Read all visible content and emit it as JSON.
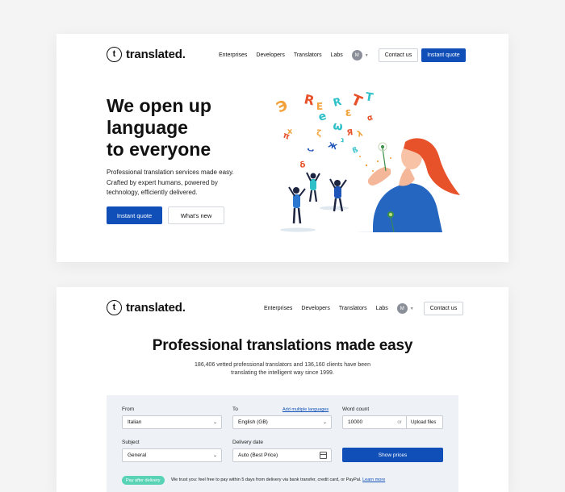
{
  "brand": {
    "name": "translated.",
    "mark": "t"
  },
  "nav": {
    "links": [
      "Enterprises",
      "Developers",
      "Translators",
      "Labs"
    ],
    "avatar_initial": "M",
    "contact_label": "Contact us",
    "quote_label": "Instant quote"
  },
  "hero": {
    "title_lines": [
      "We open up",
      "language",
      "to everyone"
    ],
    "subtitle": "Professional translation services made easy. Crafted by expert humans, powered by technology, efficiently delivered.",
    "primary_cta": "Instant quote",
    "secondary_cta": "What's new",
    "illustration_letters": [
      "Э",
      "R",
      "E",
      "R",
      "T",
      "T",
      "x",
      "e",
      "π",
      "ω",
      "ε",
      "α",
      "Ж",
      "ג",
      "Я",
      "λ",
      "ب",
      "ζ",
      "δ",
      "ß"
    ]
  },
  "section2": {
    "title": "Professional translations made easy",
    "subtitle": "186,406 vetted professional translators and 136,160 clients have been translating the intelligent way since 1999."
  },
  "form": {
    "from_label": "From",
    "from_value": "Italian",
    "to_label": "To",
    "add_languages_link": "Add multiple languages",
    "to_value": "English (GB)",
    "word_count_label": "Word count",
    "word_count_value": "10000",
    "or_text": "or",
    "upload_label": "Upload files",
    "subject_label": "Subject",
    "subject_value": "General",
    "delivery_label": "Delivery date",
    "delivery_value": "Auto (Best Price)",
    "show_prices_label": "Show prices",
    "pay_badge": "Pay after delivery",
    "trust_text": "We trust you: feel free to pay within 5 days from delivery via bank transfer, credit card, or PayPal.",
    "learn_more": "Learn more"
  },
  "colors": {
    "primary": "#0f4fb7",
    "badge": "#59d3b6",
    "panel": "#eef2f6"
  }
}
